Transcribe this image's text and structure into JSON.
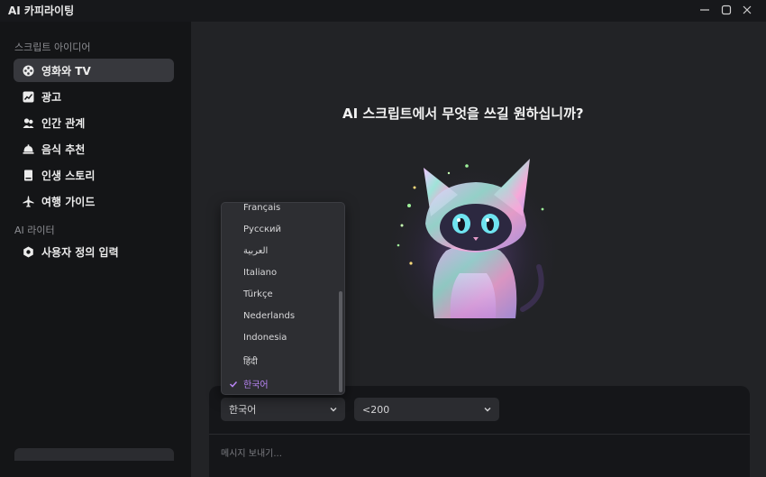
{
  "app": {
    "title": "AI 카피라이팅"
  },
  "window_controls": {
    "minimize_icon": "minimize-icon",
    "maximize_icon": "maximize-icon",
    "close_icon": "close-icon"
  },
  "sidebar": {
    "section_script": "스크립트 아이디어",
    "items": [
      {
        "label": "영화와 TV",
        "icon": "film-reel-icon",
        "active": true
      },
      {
        "label": "광고",
        "icon": "chart-icon",
        "active": false
      },
      {
        "label": "인간 관계",
        "icon": "people-icon",
        "active": false
      },
      {
        "label": "음식 추천",
        "icon": "food-cloche-icon",
        "active": false
      },
      {
        "label": "인생 스토리",
        "icon": "book-icon",
        "active": false
      },
      {
        "label": "여행 가이드",
        "icon": "airplane-icon",
        "active": false
      }
    ],
    "section_writer": "AI 라이터",
    "writer_items": [
      {
        "label": "사용자 정의 입력",
        "icon": "hexagon-gear-icon"
      }
    ]
  },
  "main": {
    "headline": "AI 스크립트에서 무엇을 쓰길 원하십니까?"
  },
  "composer": {
    "language_select": "한국어",
    "length_select": "<200",
    "placeholder": "메시지 보내기..."
  },
  "language_dropdown": {
    "options": [
      "Français",
      "Русский",
      "العربية",
      "Italiano",
      "Türkçe",
      "Nederlands",
      "Indonesia",
      "हिंदी",
      "한국어"
    ],
    "selected": "한국어",
    "accent_color": "#b985f5"
  }
}
